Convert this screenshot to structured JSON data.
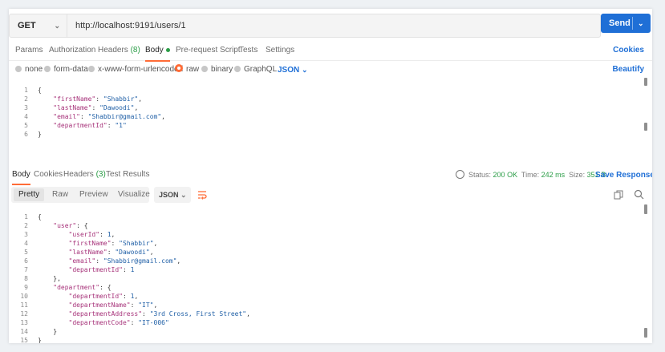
{
  "request": {
    "method": "GET",
    "url": "http://localhost:9191/users/1",
    "send_label": "Send",
    "tabs": [
      {
        "label": "Params"
      },
      {
        "label": "Authorization"
      },
      {
        "label": "Headers",
        "count": "(8)"
      },
      {
        "label": "Body",
        "active": true
      },
      {
        "label": "Pre-request Script"
      },
      {
        "label": "Tests"
      },
      {
        "label": "Settings"
      }
    ],
    "cookies_link": "Cookies",
    "body_options": [
      "none",
      "form-data",
      "x-www-form-urlencoded",
      "raw",
      "binary",
      "GraphQL"
    ],
    "selected_body_option": "raw",
    "format": "JSON",
    "beautify_link": "Beautify",
    "body_lines": [
      {
        "n": "1",
        "text": "{"
      },
      {
        "n": "2",
        "text": "    \"firstName\": \"Shabbir\","
      },
      {
        "n": "3",
        "text": "    \"lastName\": \"Dawoodi\","
      },
      {
        "n": "4",
        "text": "    \"email\": \"Shabbir@gmail.com\","
      },
      {
        "n": "5",
        "text": "    \"departmentId\": \"1\""
      },
      {
        "n": "6",
        "text": "}"
      }
    ]
  },
  "response": {
    "tabs": [
      {
        "label": "Body",
        "active": true
      },
      {
        "label": "Cookies"
      },
      {
        "label": "Headers",
        "count": "(3)"
      },
      {
        "label": "Test Results"
      }
    ],
    "status_label": "Status:",
    "status_value": "200 OK",
    "time_label": "Time:",
    "time_value": "242 ms",
    "size_label": "Size:",
    "size_value": "351 B",
    "save_response": "Save Response",
    "view_modes": [
      "Pretty",
      "Raw",
      "Preview",
      "Visualize"
    ],
    "active_view": "Pretty",
    "format": "JSON",
    "body_lines": [
      {
        "n": "1",
        "text": "{"
      },
      {
        "n": "2",
        "text": "    \"user\": {"
      },
      {
        "n": "3",
        "text": "        \"userId\": 1,"
      },
      {
        "n": "4",
        "text": "        \"firstName\": \"Shabbir\","
      },
      {
        "n": "5",
        "text": "        \"lastName\": \"Dawoodi\","
      },
      {
        "n": "6",
        "text": "        \"email\": \"Shabbir@gmail.com\","
      },
      {
        "n": "7",
        "text": "        \"departmentId\": 1"
      },
      {
        "n": "8",
        "text": "    },"
      },
      {
        "n": "9",
        "text": "    \"department\": {"
      },
      {
        "n": "10",
        "text": "        \"departmentId\": 1,"
      },
      {
        "n": "11",
        "text": "        \"departmentName\": \"IT\","
      },
      {
        "n": "12",
        "text": "        \"departmentAddress\": \"3rd Cross, First Street\","
      },
      {
        "n": "13",
        "text": "        \"departmentCode\": \"IT-006\""
      },
      {
        "n": "14",
        "text": "    }"
      },
      {
        "n": "15",
        "text": "}"
      }
    ]
  },
  "colors": {
    "accent": "#ff6c37",
    "primary": "#1f6fd6",
    "success": "#2b9d47",
    "json_key": "#a7337a",
    "json_string": "#1f5fa6"
  }
}
